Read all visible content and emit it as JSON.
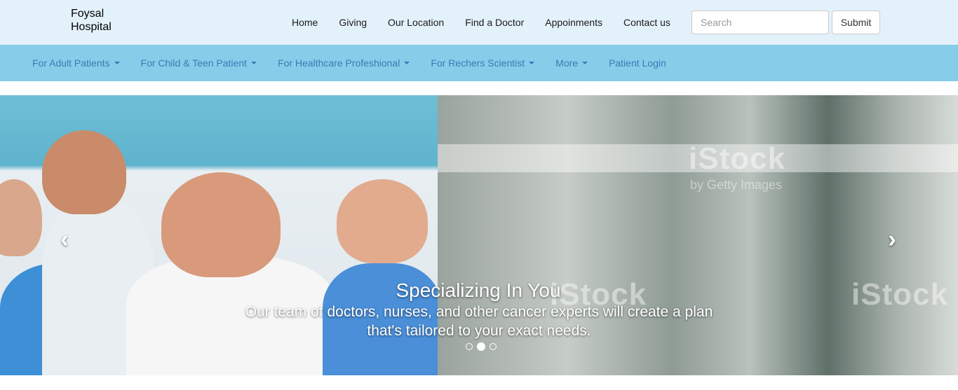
{
  "brand": {
    "line1": "Foysal",
    "line2": "Hospital"
  },
  "top_nav": [
    "Home",
    "Giving",
    "Our Location",
    "Find a Doctor",
    "Appoinments",
    "Contact us"
  ],
  "search": {
    "placeholder": "Search",
    "value": "",
    "submit_label": "Submit"
  },
  "sub_nav": [
    {
      "label": "For Adult Patients",
      "dropdown": true
    },
    {
      "label": "For Child & Teen Patient",
      "dropdown": true
    },
    {
      "label": "For Healthcare Profeshional",
      "dropdown": true
    },
    {
      "label": "For Rechers Scientist",
      "dropdown": true
    },
    {
      "label": "More",
      "dropdown": true
    },
    {
      "label": "Patient Login",
      "dropdown": false
    }
  ],
  "carousel": {
    "caption_title": "Specializing In You",
    "caption_text": "Our team of doctors, nurses, and other cancer experts will create a plan that's tailored to your exact needs.",
    "slide_count": 3,
    "active_index": 1,
    "watermark": "iStock",
    "watermark_sub": "by Getty Images",
    "prev_icon": "chevron-left-icon",
    "next_icon": "chevron-right-icon"
  },
  "colors": {
    "topbar_bg": "#e3f1fb",
    "subnav_bg": "#86cde9",
    "subnav_link": "#3a7bb6"
  }
}
